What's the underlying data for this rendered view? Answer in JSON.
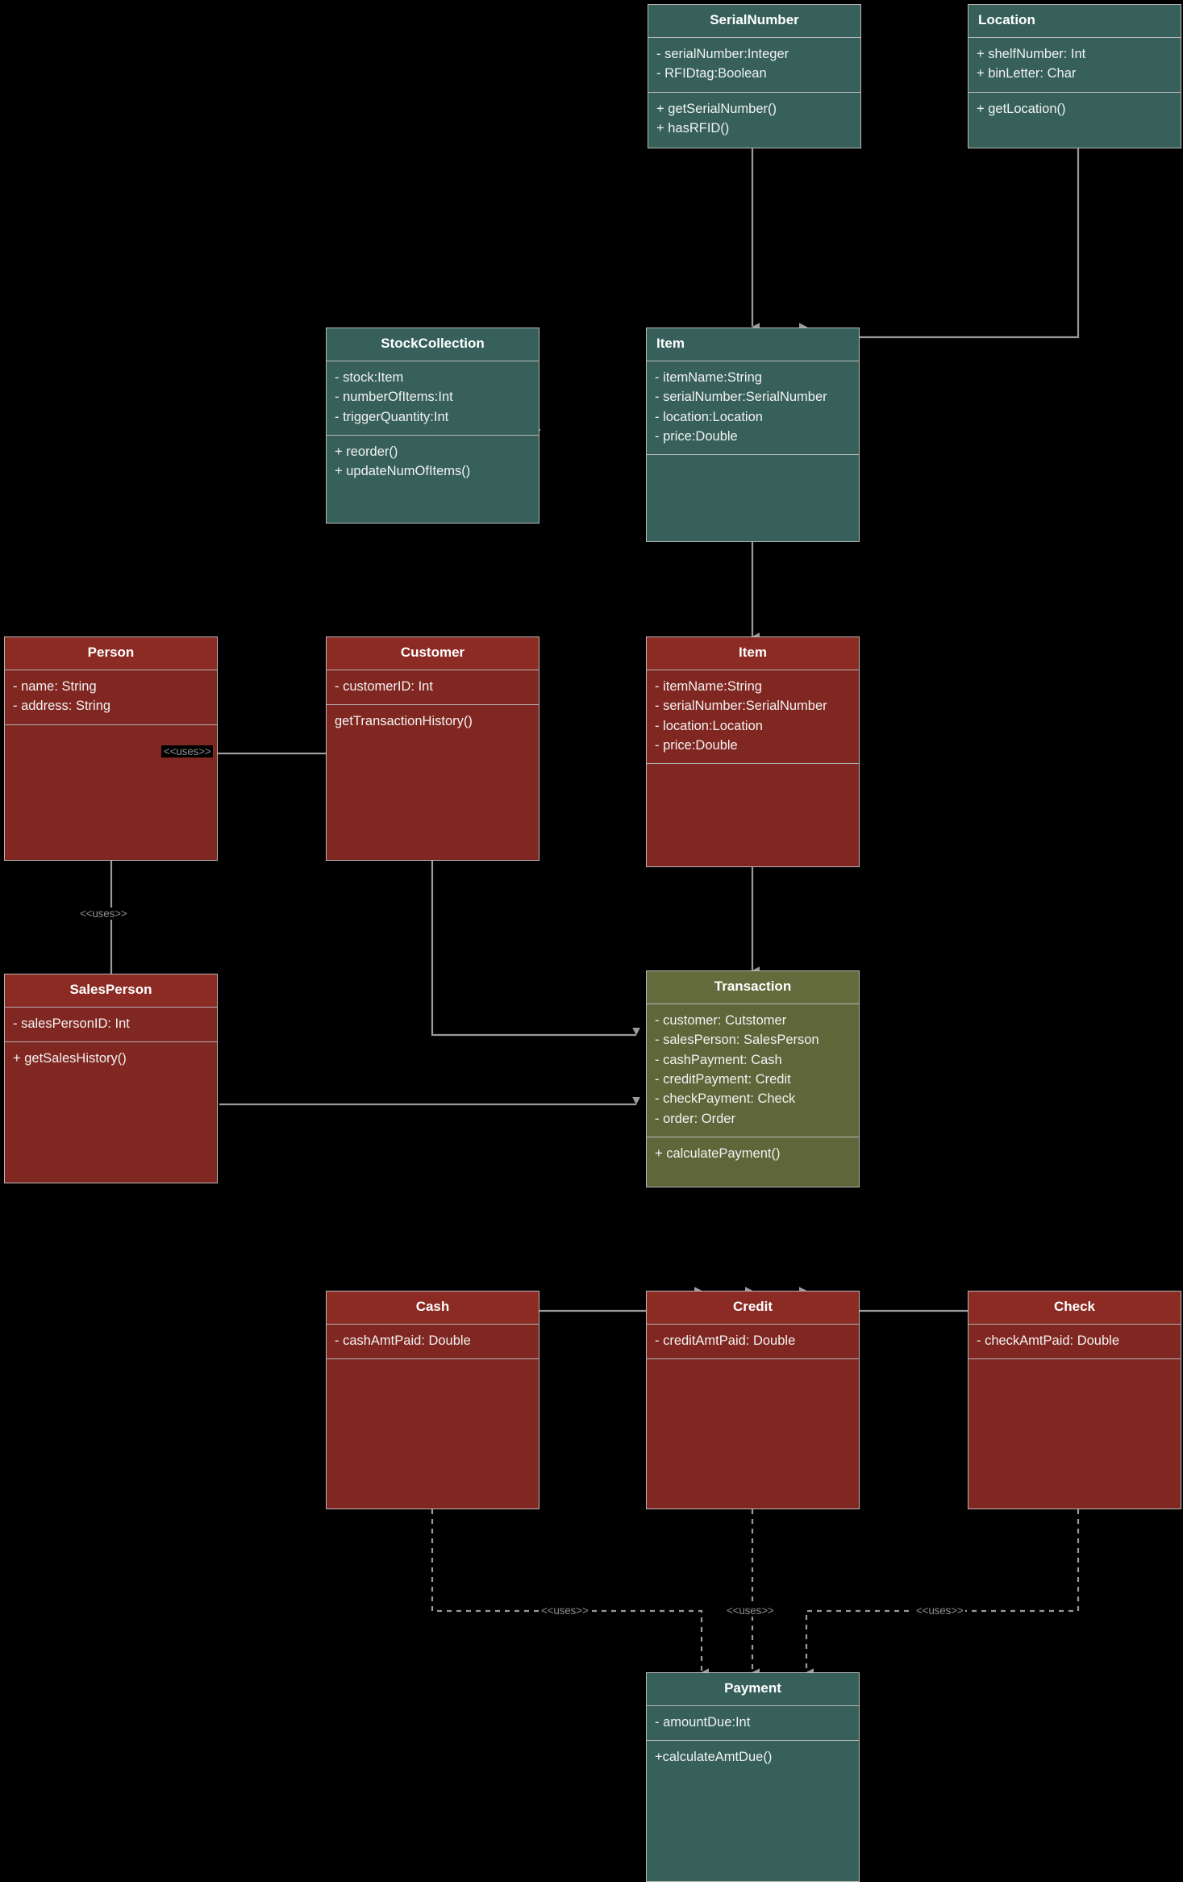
{
  "diagram": {
    "kind": "uml-class-diagram",
    "background": "#000000",
    "palette": {
      "teal": "#366059",
      "red": "#812721",
      "olive": "#5f6639",
      "edge": "#9a9a9a",
      "border": "#b9b9b9",
      "text": "#f2f2f2"
    }
  },
  "classes": {
    "serialnumber": {
      "name": "SerialNumber",
      "color": "teal",
      "attributes": [
        "- serialNumber:Integer",
        "- RFIDtag:Boolean"
      ],
      "methods": [
        "+ getSerialNumber()",
        "+ hasRFID()"
      ]
    },
    "location": {
      "name": "Location",
      "color": "teal",
      "attributes": [
        "+ shelfNumber: Int",
        "+ binLetter: Char"
      ],
      "methods": [
        "+ getLocation()"
      ]
    },
    "stockcollection": {
      "name": "StockCollection",
      "color": "teal",
      "attributes": [
        "- stock:Item",
        "- numberOfItems:Int",
        "- triggerQuantity:Int"
      ],
      "methods": [
        "+ reorder()",
        "+ updateNumOfItems()"
      ]
    },
    "item_top": {
      "name": "Item",
      "color": "teal",
      "attributes": [
        "- itemName:String",
        "- serialNumber:SerialNumber",
        "- location:Location",
        "- price:Double"
      ],
      "methods": []
    },
    "person": {
      "name": "Person",
      "color": "red",
      "attributes": [
        "- name: String",
        "- address: String"
      ],
      "methods": []
    },
    "customer": {
      "name": "Customer",
      "color": "red",
      "attributes": [
        "- customerID: Int"
      ],
      "methods": [
        "getTransactionHistory()"
      ]
    },
    "item_bottom": {
      "name": "Item",
      "color": "red",
      "attributes": [
        "- itemName:String",
        "- serialNumber:SerialNumber",
        "- location:Location",
        "- price:Double"
      ],
      "methods": []
    },
    "salesperson": {
      "name": "SalesPerson",
      "color": "red",
      "attributes": [
        "- salesPersonID: Int"
      ],
      "methods": [
        "+ getSalesHistory()"
      ]
    },
    "transaction": {
      "name": "Transaction",
      "color": "olive",
      "attributes": [
        "- customer: Cutstomer",
        "- salesPerson: SalesPerson",
        "- cashPayment: Cash",
        "- creditPayment: Credit",
        "- checkPayment: Check",
        "- order: Order"
      ],
      "methods": [
        "+ calculatePayment()"
      ]
    },
    "cash": {
      "name": "Cash",
      "color": "red",
      "attributes": [
        "- cashAmtPaid: Double"
      ],
      "methods": []
    },
    "credit": {
      "name": "Credit",
      "color": "red",
      "attributes": [
        "- creditAmtPaid: Double"
      ],
      "methods": []
    },
    "check": {
      "name": "Check",
      "color": "red",
      "attributes": [
        "- checkAmtPaid: Double"
      ],
      "methods": []
    },
    "payment": {
      "name": "Payment",
      "color": "teal",
      "attributes": [
        "- amountDue:Int"
      ],
      "methods": [
        "+calculateAmtDue()"
      ]
    }
  },
  "relationships": {
    "customer_person": {
      "label": "<<uses>>"
    },
    "person_salesperson": {
      "label": "<<uses>>"
    },
    "cash_payment": {
      "label": "<<uses>>"
    },
    "credit_payment": {
      "label": "<<uses>>"
    },
    "check_payment": {
      "label": "<<uses>>"
    }
  }
}
